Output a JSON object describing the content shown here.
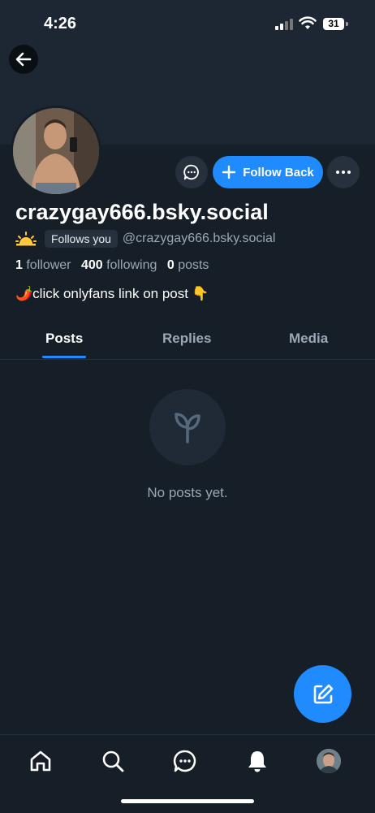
{
  "status_bar": {
    "time": "4:26",
    "battery": "31"
  },
  "profile": {
    "display_name": "crazygay666.bsky.social",
    "follows_you_label": "Follows you",
    "handle": "@crazygay666.bsky.social",
    "followers_count": "1",
    "followers_label": "follower",
    "following_count": "400",
    "following_label": "following",
    "posts_count": "0",
    "posts_label": "posts",
    "bio_text": "click onlyfans link on post",
    "bio_emoji_start": "🌶️",
    "bio_emoji_end": "👇"
  },
  "actions": {
    "follow_button_label": "Follow Back"
  },
  "tabs": [
    {
      "label": "Posts",
      "active": true
    },
    {
      "label": "Replies",
      "active": false
    },
    {
      "label": "Media",
      "active": false
    }
  ],
  "feed": {
    "empty_message": "No posts yet."
  },
  "colors": {
    "accent": "#208bfe",
    "background": "#161e27",
    "muted_text": "#9aa8b6"
  },
  "icons": {
    "back": "arrow-left-icon",
    "message": "chat-bubble-icon",
    "follow": "plus-icon",
    "more": "ellipsis-icon",
    "empty": "sprout-icon",
    "compose": "compose-icon",
    "nav": [
      "home-icon",
      "search-icon",
      "chat-icon",
      "bell-icon",
      "profile-avatar"
    ]
  }
}
